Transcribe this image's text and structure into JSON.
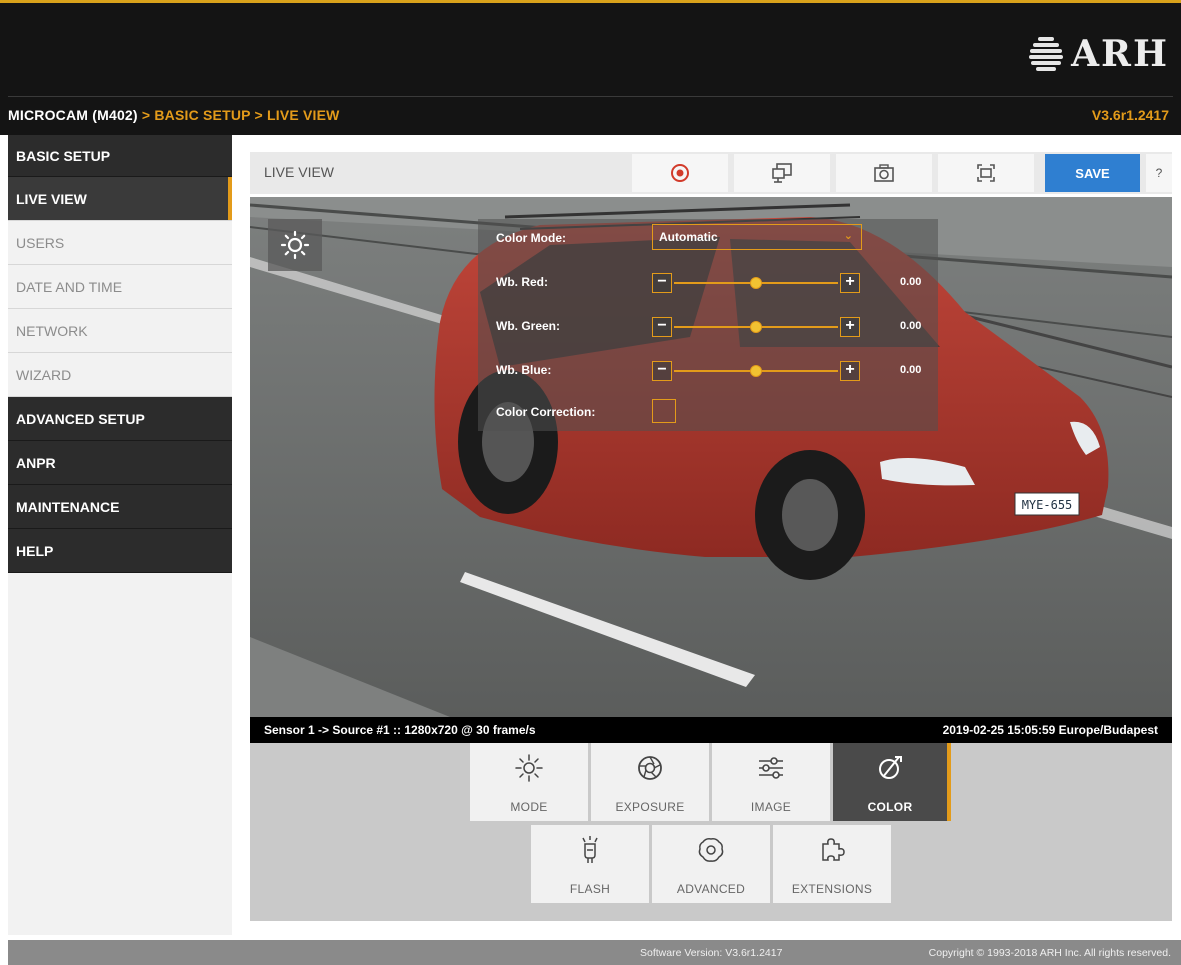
{
  "header": {
    "logo_text": "ARH",
    "breadcrumb": [
      "MICROCAM (M402)",
      "BASIC SETUP",
      "LIVE VIEW"
    ],
    "separator": " > ",
    "version": "V3.6r1.2417",
    "accent_color": "#e39b1a"
  },
  "sidebar": {
    "items": [
      {
        "label": "BASIC SETUP",
        "kind": "section"
      },
      {
        "label": "LIVE VIEW",
        "kind": "active"
      },
      {
        "label": "USERS",
        "kind": "item"
      },
      {
        "label": "DATE AND TIME",
        "kind": "item"
      },
      {
        "label": "NETWORK",
        "kind": "item"
      },
      {
        "label": "WIZARD",
        "kind": "item"
      },
      {
        "label": "ADVANCED SETUP",
        "kind": "section"
      },
      {
        "label": "ANPR",
        "kind": "section"
      },
      {
        "label": "MAINTENANCE",
        "kind": "section"
      },
      {
        "label": "HELP",
        "kind": "section"
      }
    ]
  },
  "toolbar": {
    "title": "LIVE VIEW",
    "icons": [
      "record-icon",
      "display-icon",
      "camera-icon",
      "frame-capture-icon"
    ],
    "save_label": "SAVE",
    "help_label": "?",
    "save_color": "#2f7fd1"
  },
  "color_panel": {
    "mode_label": "Color Mode:",
    "mode_value": "Automatic",
    "sliders": [
      {
        "label": "Wb. Red:",
        "value": "0.00",
        "level": 0.5
      },
      {
        "label": "Wb. Green:",
        "value": "0.00",
        "level": 0.5
      },
      {
        "label": "Wb. Blue:",
        "value": "0.00",
        "level": 0.5
      }
    ],
    "correction_label": "Color Correction:",
    "correction_checked": false
  },
  "status": {
    "source": "Sensor 1 -> Source #1 :: 1280x720 @ 30 frame/s",
    "timestamp": "2019-02-25 15:05:59 Europe/Budapest"
  },
  "video": {
    "plate": "MYE-655"
  },
  "tabs": {
    "row1": [
      {
        "label": "MODE",
        "icon": "sun-icon",
        "active": false
      },
      {
        "label": "EXPOSURE",
        "icon": "aperture-icon",
        "active": false
      },
      {
        "label": "IMAGE",
        "icon": "sliders-icon",
        "active": false
      },
      {
        "label": "COLOR",
        "icon": "color-icon",
        "active": true
      }
    ],
    "row2": [
      {
        "label": "FLASH",
        "icon": "flash-bulb-icon",
        "active": false
      },
      {
        "label": "ADVANCED",
        "icon": "gear-brain-icon",
        "active": false
      },
      {
        "label": "EXTENSIONS",
        "icon": "puzzle-icon",
        "active": false
      }
    ]
  },
  "footer": {
    "software_version": "Software Version:   V3.6r1.2417",
    "copyright": "Copyright © 1993-2018 ARH Inc. All rights reserved."
  }
}
